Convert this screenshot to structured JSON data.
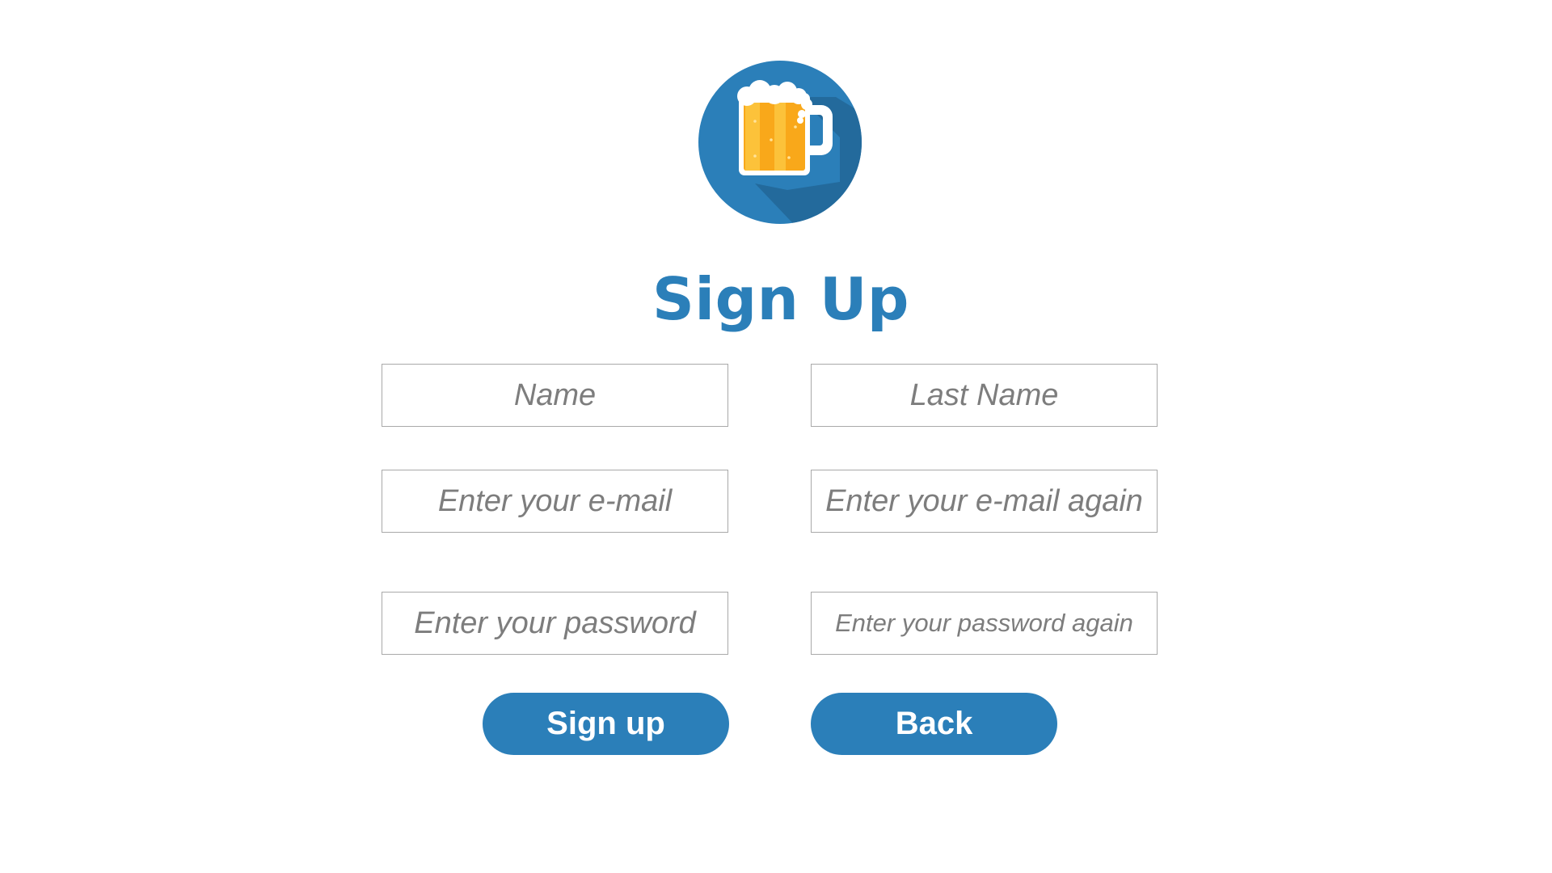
{
  "theme": {
    "accent": "#2b7fb9",
    "logo_circle": "#2b7fb9",
    "logo_shadow": "#236a9c",
    "beer": "#f9a81a",
    "beer_light": "#fcc23a",
    "foam": "#ffffff"
  },
  "logo": {
    "icon": "beer-mug-icon"
  },
  "page": {
    "title": "Sign Up"
  },
  "form": {
    "name_placeholder": "Name",
    "last_name_placeholder": "Last Name",
    "email_placeholder": "Enter your e-mail",
    "email_again_placeholder": "Enter your e-mail again",
    "password_placeholder": "Enter your password",
    "password_again_placeholder": "Enter your password again"
  },
  "buttons": {
    "signup_label": "Sign up",
    "back_label": "Back"
  }
}
